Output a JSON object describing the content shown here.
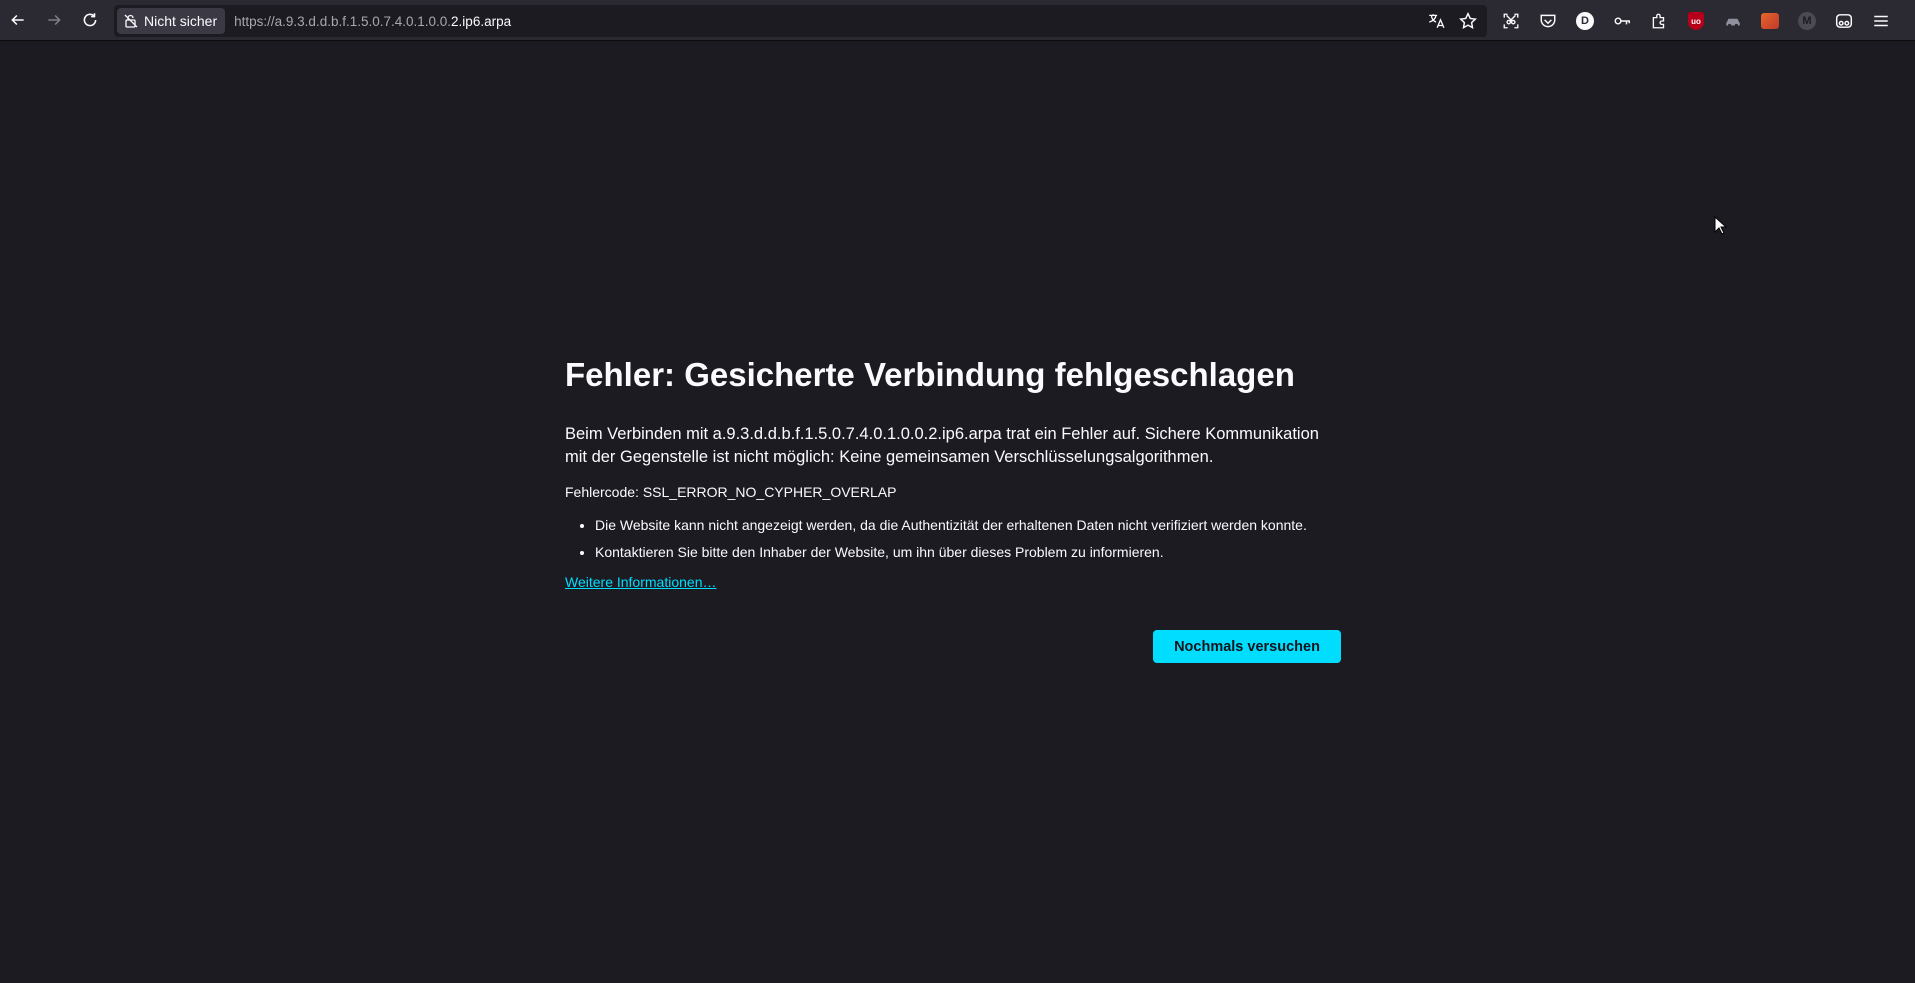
{
  "toolbar": {
    "security_label": "Nicht sicher",
    "url_prefix": "https://a.9.3.d.d.b.f.1.5.0.7.4.0.1.0.0.",
    "url_host": "2.ip6.arpa",
    "icons": [
      "back-icon",
      "forward-icon",
      "reload-icon",
      "translate-icon",
      "bookmark-star-icon",
      "screenshot-icon",
      "pocket-icon",
      "dashlane-icon",
      "password-key-icon",
      "extensions-icon",
      "ublock-icon",
      "extension-car-icon",
      "extension-fox-icon",
      "extension-m-icon",
      "extension-glasses-icon",
      "menu-icon"
    ],
    "ext_labels": {
      "d": "D",
      "ub": "uo",
      "m": "M"
    }
  },
  "error": {
    "title": "Fehler: Gesicherte Verbindung fehlgeschlagen",
    "intro": "Beim Verbinden mit a.9.3.d.d.b.f.1.5.0.7.4.0.1.0.0.2.ip6.arpa trat ein Fehler auf. Sichere Kommunikation mit der Gegenstelle ist nicht möglich: Keine gemeinsamen Verschlüsselungsalgorithmen.",
    "code": "Fehlercode: SSL_ERROR_NO_CYPHER_OVERLAP",
    "bullets": [
      "Die Website kann nicht angezeigt werden, da die Authentizität der erhaltenen Daten nicht verifiziert werden konnte.",
      "Kontaktieren Sie bitte den Inhaber der Website, um ihn über dieses Problem zu informieren."
    ],
    "more_link": "Weitere Informationen…",
    "retry_button": "Nochmals versuchen"
  },
  "colors": {
    "background": "#1c1b22",
    "toolbar": "#2b2a33",
    "accent": "#00ddff"
  }
}
